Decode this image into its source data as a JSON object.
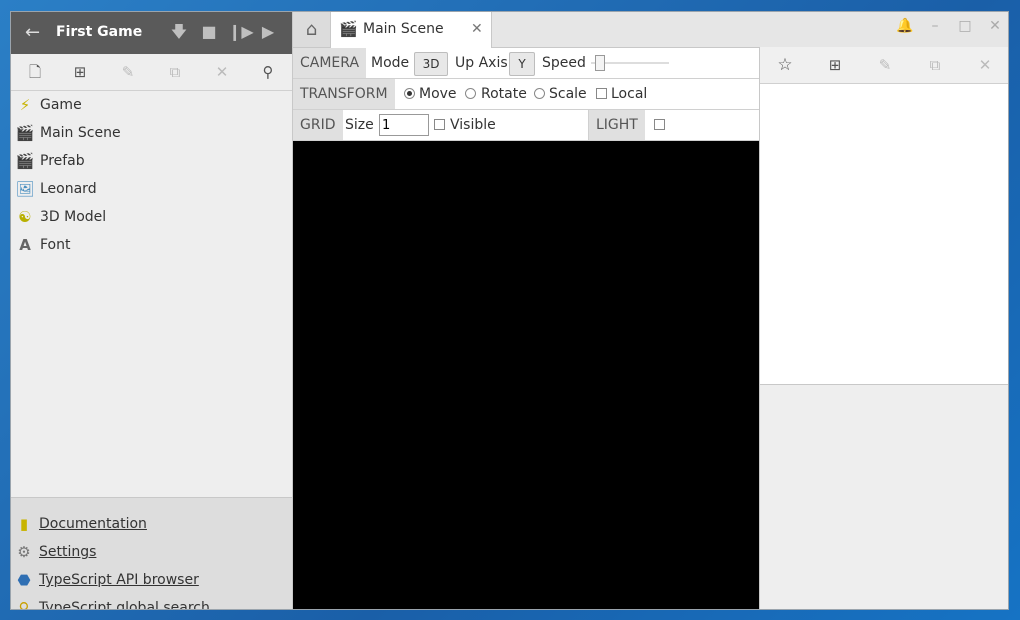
{
  "left_panel": {
    "header": {
      "back_icon": "arrow-left-icon",
      "title": "First Game",
      "buttons": [
        "download-icon",
        "stop-icon",
        "debug-icon",
        "play-icon"
      ]
    },
    "toolbar": [
      "new-asset-icon",
      "new-folder-icon",
      "rename-icon",
      "duplicate-icon",
      "delete-icon",
      "search-icon"
    ],
    "assets": [
      {
        "icon": "lightning-icon",
        "label": "Game"
      },
      {
        "icon": "clapperboard-icon",
        "label": "Main Scene"
      },
      {
        "icon": "clapperboard-icon",
        "label": "Prefab"
      },
      {
        "icon": "image-icon",
        "label": "Leonard"
      },
      {
        "icon": "person-model-icon",
        "label": "3D Model"
      },
      {
        "icon": "font-icon",
        "label": "Font"
      }
    ],
    "links": [
      {
        "icon": "book-icon",
        "label": "Documentation"
      },
      {
        "icon": "gear-icon",
        "label": "Settings"
      },
      {
        "icon": "cube-icon",
        "label": "TypeScript API browser"
      },
      {
        "icon": "magnifier-icon",
        "label": "TypeScript global search"
      }
    ]
  },
  "tabs": [
    {
      "label": "Main Scene",
      "icon": "clapperboard-icon"
    }
  ],
  "scene_toolbar": {
    "camera": {
      "label": "CAMERA",
      "mode_label": "Mode",
      "mode_value": "3D",
      "up_axis_label": "Up Axis",
      "up_axis_value": "Y",
      "speed_label": "Speed",
      "speed_value": 0.1
    },
    "transform": {
      "label": "TRANSFORM",
      "options": [
        "Move",
        "Rotate",
        "Scale"
      ],
      "selected": "Move",
      "local_label": "Local",
      "local_checked": false
    },
    "grid": {
      "label": "GRID",
      "size_label": "Size",
      "size_value": "1",
      "visible_label": "Visible",
      "visible_checked": false
    },
    "light": {
      "label": "LIGHT",
      "checked": false
    }
  },
  "right_panel": {
    "toolbar": [
      "prefab-star-icon",
      "add-component-icon",
      "rename-icon",
      "duplicate-icon",
      "delete-icon"
    ]
  },
  "colors": {
    "header_bg": "#5a5a5a",
    "viewport_bg": "#000000",
    "panel_bg": "#eeeeee"
  }
}
